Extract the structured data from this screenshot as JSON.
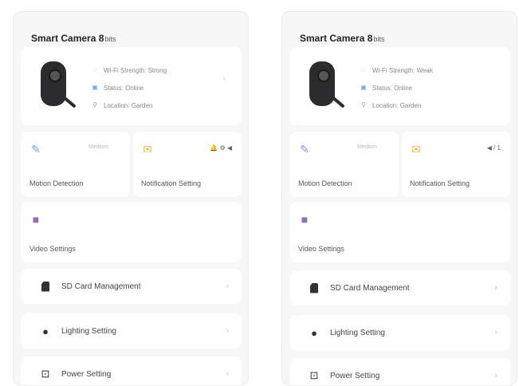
{
  "panels": [
    {
      "device": {
        "name": "Smart Camera 8",
        "suffix": "bits",
        "info": [
          {
            "icon": "wifi-icon",
            "text": "Wi-Fi Strength: Strong"
          },
          {
            "icon": "status-icon",
            "text": "Status: Online"
          },
          {
            "icon": "location-icon",
            "text": "Location: Garden"
          }
        ]
      },
      "tiles": {
        "motion": {
          "label": "Motion Detection",
          "status": "Medium",
          "icon": "pen-icon"
        },
        "notification": {
          "label": "Notification Setting",
          "status": "🔔 ⚙ ◀",
          "icon": "bell-icon"
        },
        "video": {
          "label": "Video Settings",
          "icon": "video-icon"
        }
      },
      "rows": {
        "sd": "SD Card Management",
        "lighting": "Lighting Setting",
        "power": "Power Setting"
      }
    },
    {
      "device": {
        "name": "Smart Camera 8",
        "suffix": "bits",
        "info": [
          {
            "icon": "wifi-icon",
            "text": "Wi-Fi Strength: Weak"
          },
          {
            "icon": "status-icon",
            "text": "Status: Online"
          },
          {
            "icon": "location-icon",
            "text": "Location: Garden"
          }
        ]
      },
      "tiles": {
        "motion": {
          "label": "Motion Detection",
          "status": "Medium",
          "icon": "pen-icon"
        },
        "notification": {
          "label": "Notification Setting",
          "status": "◀ / 1",
          "icon": "bell-icon"
        },
        "video": {
          "label": "Video Settings",
          "icon": "video-icon"
        }
      },
      "rows": {
        "sd": "SD Card Management",
        "lighting": "Lighting Setting",
        "power": "Power Setting"
      }
    }
  ],
  "colors": {
    "panel_bg": "#f7f7f8",
    "card_bg": "#ffffff",
    "motion_icon": "#7a9bd8",
    "bell_icon": "#f0b83a",
    "video_icon": "#8a6fc7"
  }
}
